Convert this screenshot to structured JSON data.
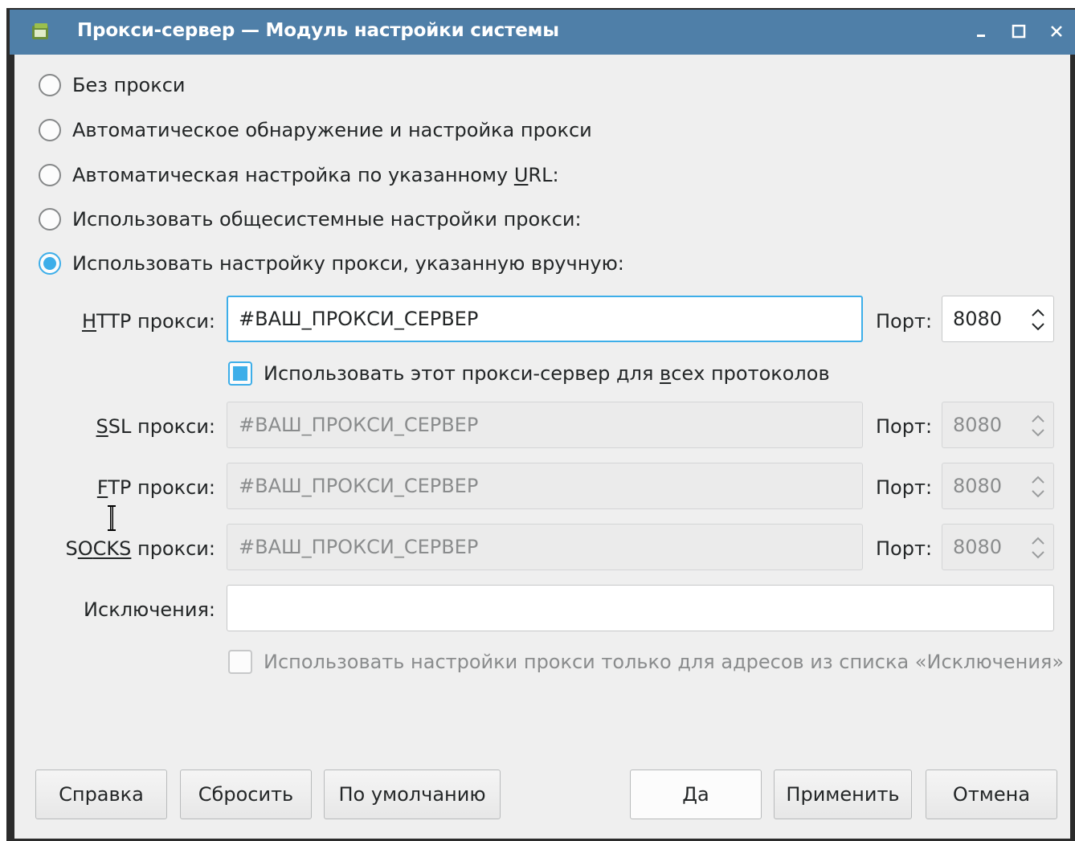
{
  "window": {
    "title": "Прокси-сервер — Модуль настройки системы",
    "accent": "#3daee9",
    "titlebar_color": "#4f7fa8"
  },
  "radio_options": [
    {
      "label": "Без прокси",
      "checked": false
    },
    {
      "label": "Автоматическое обнаружение и настройка прокси",
      "checked": false
    },
    {
      "label_pre": "Автоматическая настройка по указанному ",
      "mnemonic": "U",
      "label_post": "RL:",
      "checked": false
    },
    {
      "label": "Использовать общесистемные настройки прокси:",
      "checked": false
    },
    {
      "label": "Использовать настройку прокси, указанную вручную:",
      "checked": true
    }
  ],
  "manual": {
    "http": {
      "mn": "H",
      "rest": "TTP прокси:",
      "value": "#ВАШ_ПРОКСИ_СЕРВЕР",
      "port_label": "Порт:",
      "port": "8080"
    },
    "use_for_all": {
      "pre": "Использовать этот прокси-сервер для ",
      "mn": "в",
      "post": "сех протоколов",
      "checked": true
    },
    "ssl": {
      "mn": "S",
      "rest": "SL прокси:",
      "value": "#ВАШ_ПРОКСИ_СЕРВЕР",
      "port_label": "Порт:",
      "port": "8080"
    },
    "ftp": {
      "mn": "F",
      "rest": "TP прокси:",
      "value": "#ВАШ_ПРОКСИ_СЕРВЕР",
      "port_label": "Порт:",
      "port": "8080"
    },
    "socks": {
      "pre": "S",
      "mn": "O",
      "mid": "CKS",
      "rest": " прокси:",
      "value": "#ВАШ_ПРОКСИ_СЕРВЕР",
      "port_label": "Порт:",
      "port": "8080"
    },
    "exceptions": {
      "label": "Исключения:",
      "value": ""
    },
    "only_exceptions": {
      "label": "Использовать настройки прокси только для адресов из списка «Исключения»",
      "checked": false
    }
  },
  "buttons": {
    "help": "Справка",
    "reset": "Сбросить",
    "defaults": "По умолчанию",
    "ok": "Да",
    "apply": "Применить",
    "cancel": "Отмена"
  }
}
